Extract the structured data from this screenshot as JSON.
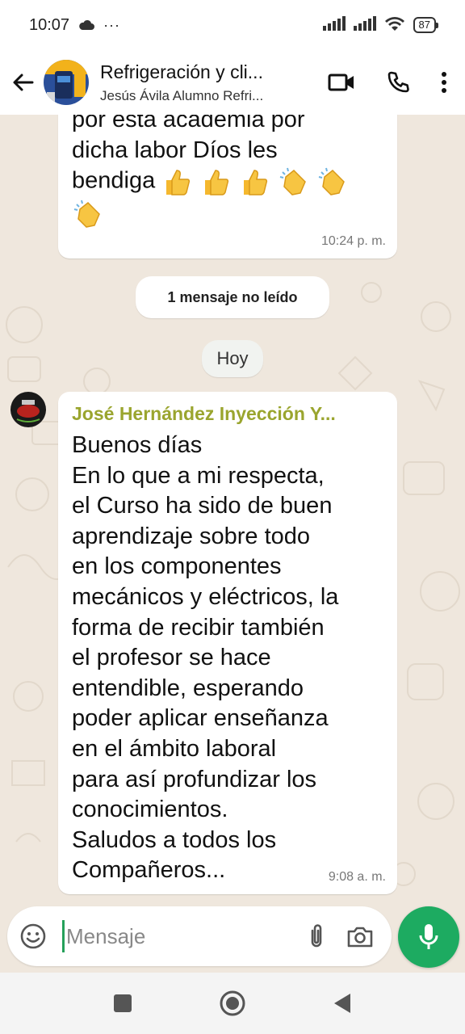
{
  "status_bar": {
    "time": "10:07",
    "extra": "···",
    "battery": "87"
  },
  "header": {
    "title": "Refrigeración y cli...",
    "subtitle": "Jesús Ávila Alumno Refri..."
  },
  "messages": [
    {
      "text": "por esta academia por\ndicha labor Díos les\nbendiga",
      "emojis": [
        "thumbs-up",
        "thumbs-up",
        "thumbs-up",
        "clapping-hands",
        "clapping-hands",
        "clapping-hands"
      ],
      "time": "10:24 p. m."
    },
    {
      "sender": "José Hernández Inyección Y...",
      "text": "Buenos días\nEn lo que a mi respecta,\nel Curso ha sido de buen\naprendizaje sobre todo\nen los componentes\nmecánicos y eléctricos,  la\nforma de recibir también\nel profesor se hace\nentendible,  esperando\npoder aplicar enseñanza\nen el ámbito laboral\npara así profundizar los\nconocimientos.\nSaludos a todos los\nCompañeros...",
      "time": "9:08 a. m."
    }
  ],
  "unread_banner": "1 mensaje no leído",
  "date_chip": "Hoy",
  "composer": {
    "placeholder": "Mensaje"
  },
  "colors": {
    "accent_green": "#1dab61",
    "sender_name": "#9aa52e",
    "chat_background": "#efe7dd"
  },
  "icons": {
    "back": "arrow-left-icon",
    "video": "video-camera-icon",
    "call": "phone-icon",
    "menu": "more-vertical-icon",
    "emoji": "smiley-icon",
    "attach": "paperclip-icon",
    "camera": "camera-icon",
    "mic": "microphone-icon"
  }
}
